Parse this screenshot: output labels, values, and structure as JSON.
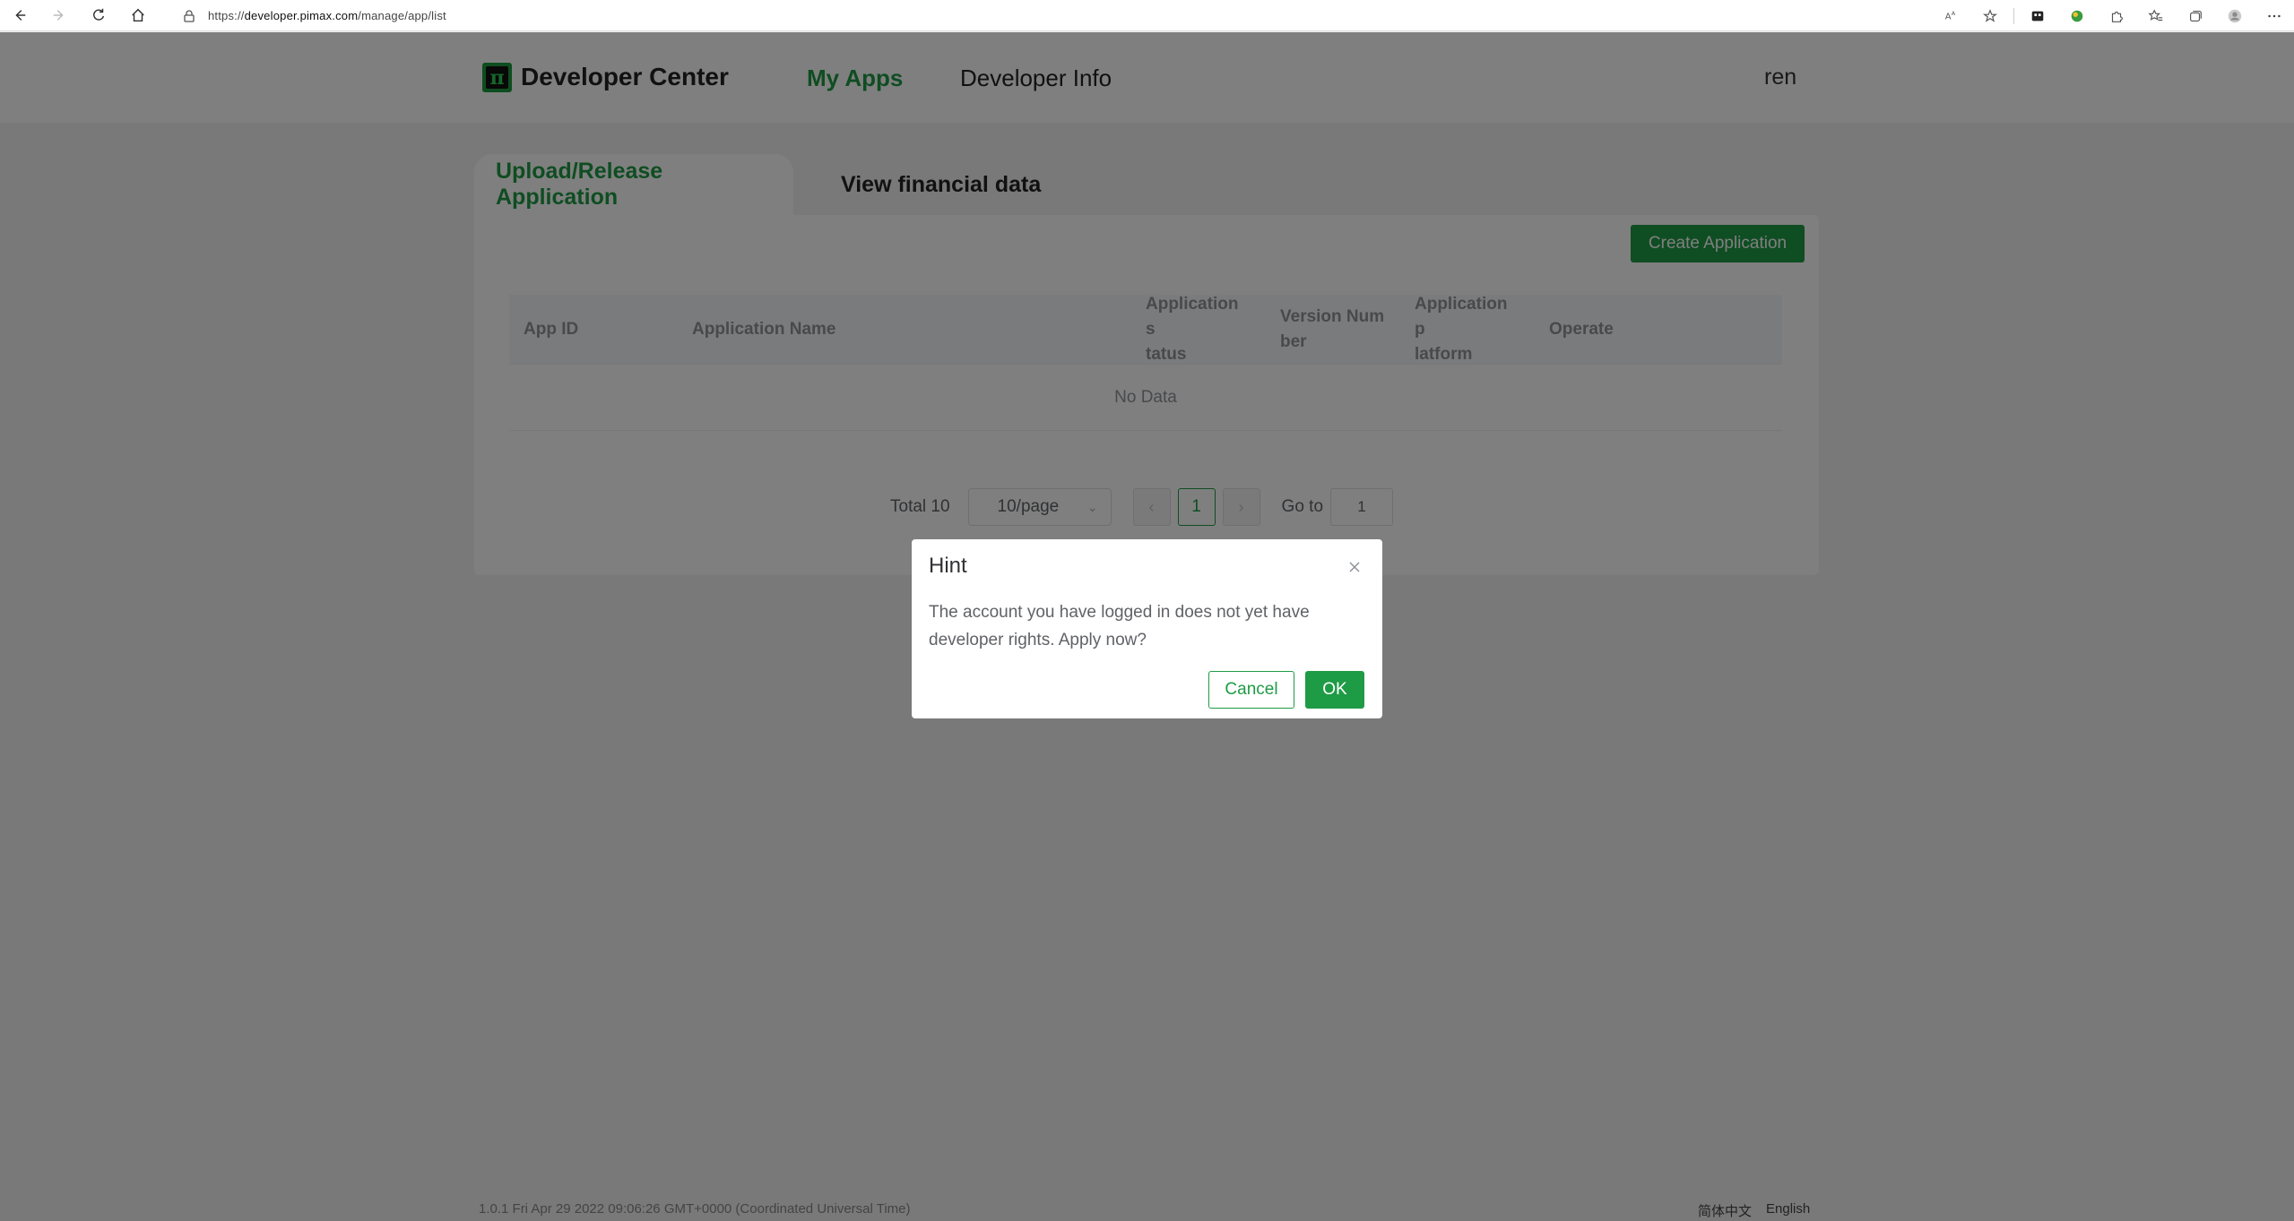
{
  "browser": {
    "url_scheme": "https://",
    "url_host": "developer.pimax.com",
    "url_path": "/manage/app/list"
  },
  "header": {
    "brand": "Developer Center",
    "logo_glyph": "π",
    "nav": [
      {
        "label": "My Apps",
        "active": true
      },
      {
        "label": "Developer Info",
        "active": false
      }
    ],
    "user": "ren"
  },
  "tabs": [
    {
      "label": "Upload/Release Application",
      "active": true
    },
    {
      "label": "View financial data",
      "active": false
    }
  ],
  "toolbar": {
    "create_label": "Create Application"
  },
  "table": {
    "columns": [
      "App ID",
      "Application Name",
      "Application s\ntatus",
      "Version Num\nber",
      "Application p\nlatform",
      "Operate"
    ],
    "empty_text": "No Data"
  },
  "pagination": {
    "total": "Total 10",
    "page_size": "10/page",
    "current_page": "1",
    "goto_label": "Go to",
    "goto_value": "1"
  },
  "footer": {
    "version": "1.0.1 Fri Apr 29 2022 09:06:26 GMT+0000 (Coordinated Universal Time)",
    "lang_zh": "简体中文",
    "lang_en": "English"
  },
  "dialog": {
    "title": "Hint",
    "message": "The account you have logged in does not yet have developer rights. Apply now?",
    "cancel": "Cancel",
    "ok": "OK"
  },
  "colors": {
    "accent": "#1e9b45",
    "overlay": "rgba(0,0,0,0.5)"
  }
}
